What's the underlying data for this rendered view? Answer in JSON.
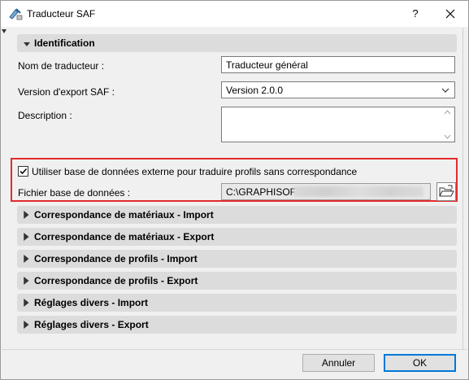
{
  "window": {
    "title": "Traducteur SAF",
    "help_label": "?",
    "close_label": "✕"
  },
  "sections": {
    "identification": "Identification",
    "collapsed": [
      "Correspondance de matériaux - Import",
      "Correspondance de matériaux - Export",
      "Correspondance de profils - Import",
      "Correspondance de profils - Export",
      "Réglages divers - Import",
      "Réglages divers - Export"
    ]
  },
  "form": {
    "translator_name_label": "Nom de traducteur :",
    "translator_name_value": "Traducteur général",
    "export_version_label": "Version d'export SAF :",
    "export_version_value": "Version 2.0.0",
    "description_label": "Description :",
    "description_value": ""
  },
  "database": {
    "checkbox_label": "Utiliser base de données externe pour traduire profils sans correspondance",
    "checked": true,
    "file_label": "Fichier base de données :",
    "file_path": "C:\\GRAPHISOFT\\"
  },
  "buttons": {
    "cancel": "Annuler",
    "ok": "OK"
  },
  "colors": {
    "highlight": "#e32b2b",
    "section_header": "#dcdcdc",
    "ok_border": "#0078d7"
  }
}
